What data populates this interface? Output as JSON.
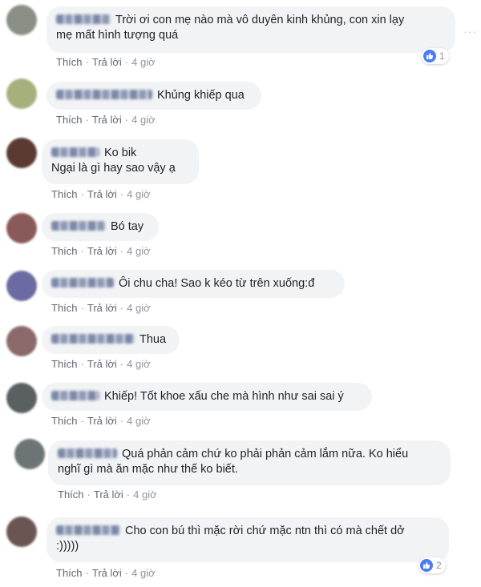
{
  "actions": {
    "like_label": "Thích",
    "reply_label": "Trả lời",
    "separator": "·"
  },
  "comments": [
    {
      "text_lines": [
        "Trời ơi con mẹ nào mà vô duyên kinh khủng, con xin lạy",
        "mẹ mất hình tượng quá"
      ],
      "time": "4 giờ",
      "reaction_count": "1",
      "avatar_color": "#8a8f85"
    },
    {
      "text_lines": [
        "Khủng khiếp qua"
      ],
      "time": "4 giờ",
      "avatar_color": "#a6b07c"
    },
    {
      "text_lines": [
        "Ko bik",
        "Ngại là gì hay sao vậy ạ"
      ],
      "time": "4 giờ",
      "avatar_color": "#5a3a32"
    },
    {
      "text_lines": [
        "Bó tay"
      ],
      "time": "4 giờ",
      "avatar_color": "#8a5a5a"
    },
    {
      "text_lines": [
        "Ôi chu cha! Sao k kéo từ trên xuống:đ"
      ],
      "time": "4 giờ",
      "avatar_color": "#6b6aa2"
    },
    {
      "text_lines": [
        "Thua"
      ],
      "time": "4 giờ",
      "avatar_color": "#8a6a6a"
    },
    {
      "text_lines": [
        "Khiếp! Tốt khoe xấu che mà hình như sai sai ý"
      ],
      "time": "4 giờ",
      "avatar_color": "#5a5f62"
    },
    {
      "text_lines": [
        "Quá phản cảm chứ ko phải phản cảm lắm nữa. Ko hiểu",
        "nghĩ gì mà ăn mặc như thế ko biết."
      ],
      "time": "4 giờ",
      "avatar_color": "#6c7476"
    },
    {
      "text_lines": [
        "Cho con bú thì mặc rời chứ mặc ntn thì có mà chết dở",
        ":)))))"
      ],
      "time": "4 giờ",
      "reaction_count": "2",
      "avatar_color": "#6a5552"
    }
  ],
  "colors": {
    "bubble_bg": "#f2f3f5",
    "text": "#1d2129",
    "action_text": "#616770",
    "like_blue": "#4b7cf2"
  }
}
